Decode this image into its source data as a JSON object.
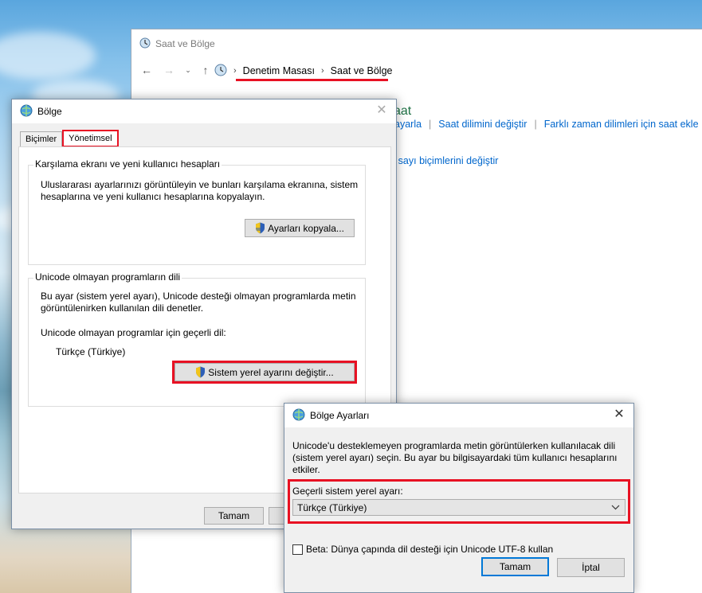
{
  "control_panel": {
    "title": "Saat ve Bölge",
    "breadcrumb": [
      "Denetim Masası",
      "Saat ve Bölge"
    ],
    "section_heading": "aat",
    "links_row": [
      "ayarla",
      "Saat dilimini değiştir",
      "Farklı zaman dilimleri için saat ekle"
    ],
    "link_partial": "ya sayı biçimlerini değiştir"
  },
  "bolge_dialog": {
    "title": "Bölge",
    "tabs": [
      "Biçimler",
      "Yönetimsel"
    ],
    "active_tab": "Yönetimsel",
    "group1": {
      "legend": "Karşılama ekranı ve yeni kullanıcı hesapları",
      "text": "Uluslararası ayarlarınızı görüntüleyin ve bunları karşılama ekranına, sistem hesaplarına ve yeni kullanıcı hesaplarına kopyalayın.",
      "button": "Ayarları kopyala..."
    },
    "group2": {
      "legend": "Unicode olmayan programların dili",
      "text": "Bu ayar (sistem yerel ayarı), Unicode desteği olmayan programlarda metin görüntülenirken kullanılan dili denetler.",
      "current_label": "Unicode olmayan programlar için geçerli dil:",
      "current_value": "Türkçe (Türkiye)",
      "button": "Sistem yerel ayarını değiştir..."
    },
    "ok_button": "Tamam"
  },
  "ayar_dialog": {
    "title": "Bölge Ayarları",
    "description": "Unicode'u desteklemeyen programlarda metin görüntülerken kullanılacak dili (sistem yerel ayarı) seçin. Bu ayar bu bilgisayardaki tüm kullanıcı hesaplarını etkiler.",
    "locale_label": "Geçerli sistem yerel ayarı:",
    "locale_value": "Türkçe (Türkiye)",
    "beta_label": "Beta: Dünya çapında dil desteği için Unicode UTF-8 kullan",
    "beta_checked": false,
    "ok_button": "Tamam",
    "cancel_button": "İptal"
  },
  "colors": {
    "highlight": "#e81123",
    "link": "#0066cc",
    "heading_green": "#1e7145"
  }
}
